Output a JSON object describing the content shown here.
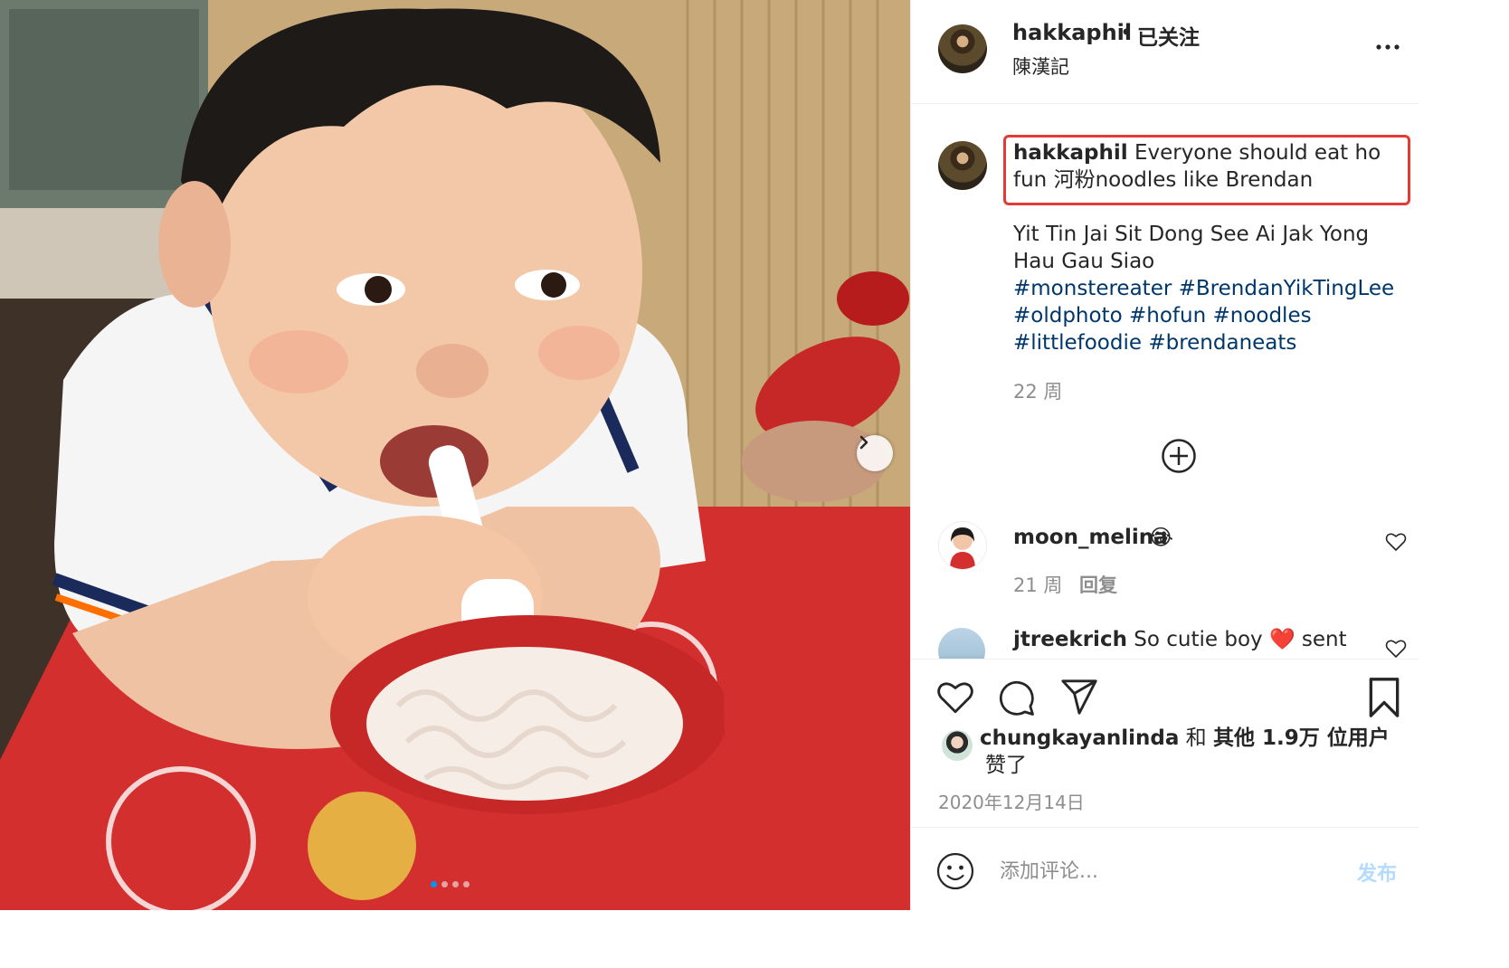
{
  "post": {
    "username": "hakkaphil",
    "separator": "•",
    "follow_status": "已关注",
    "location": "陳漢記"
  },
  "caption": {
    "username": "hakkaphil",
    "text": "Everyone should eat ho fun 河粉noodles like Brendan",
    "body": "Yit Tin Jai Sit Dong See Ai Jak Yong Hau Gau Siao",
    "hashtags": [
      "#monstereater",
      "#BrendanYikTingLee",
      "#oldphoto",
      "#hofun",
      "#noodles",
      "#littlefoodie",
      "#brendaneats"
    ],
    "time": "22 周"
  },
  "comments": [
    {
      "username": "moon_melina",
      "emoji": "😂",
      "time": "21 周",
      "reply_label": "回复"
    },
    {
      "username": "jtreekrich",
      "text": "So cutie boy",
      "emoji": "❤️",
      "trail": "sent"
    }
  ],
  "likes": {
    "username": "chungkayanlinda",
    "connector": "和",
    "others": "其他 1.9万 位用户",
    "suffix": "赞了"
  },
  "post_date": "2020年12月14日",
  "add_comment": {
    "placeholder": "添加评论...",
    "post_label": "发布"
  },
  "carousel": {
    "count": 4,
    "active_index": 0
  },
  "icons": {
    "next": "chevron-right-icon",
    "more": "more-options-icon",
    "plus": "load-more-comments-icon",
    "heart": "heart-icon",
    "comment": "comment-icon",
    "share": "share-icon",
    "save": "bookmark-icon",
    "emoji": "emoji-icon"
  },
  "colors": {
    "link": "#00376b",
    "meta": "#8e8e8e",
    "highlight_box": "#e53935",
    "post_button_disabled": "#b3dbff",
    "active_dot": "#0095f6"
  }
}
